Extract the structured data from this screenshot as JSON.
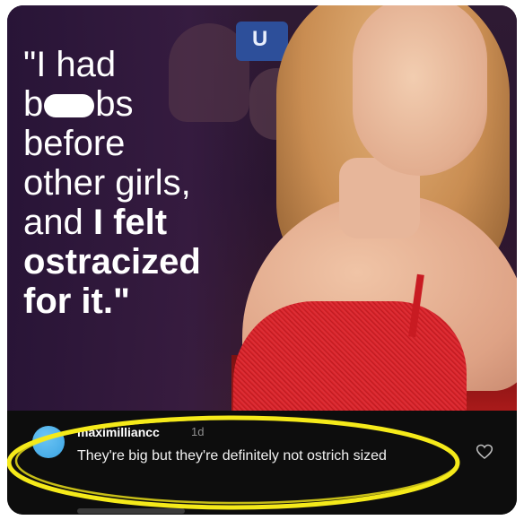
{
  "post": {
    "quote_lines": [
      {
        "text": "\"I had",
        "bold": false
      },
      {
        "pre": "b",
        "post": "bs",
        "censored": true
      },
      {
        "text": "before",
        "bold": false
      },
      {
        "text": "other girls,",
        "bold": false
      },
      {
        "pre": "and ",
        "bold_part": "I felt"
      },
      {
        "text": "ostracized",
        "bold": true
      },
      {
        "text": "for it.\"",
        "bold": true
      }
    ],
    "background_sign_letter": "U"
  },
  "comment": {
    "username": "maximilliancc",
    "time": "1d",
    "text": "They're big but they're definitely not ostrich sized",
    "like_icon": "heart-outline-icon"
  },
  "colors": {
    "highlight": "#f5ea1a",
    "avatar": "#3aa4e4",
    "dress": "#d51f24",
    "panel_bg": "#0d0d0d"
  }
}
